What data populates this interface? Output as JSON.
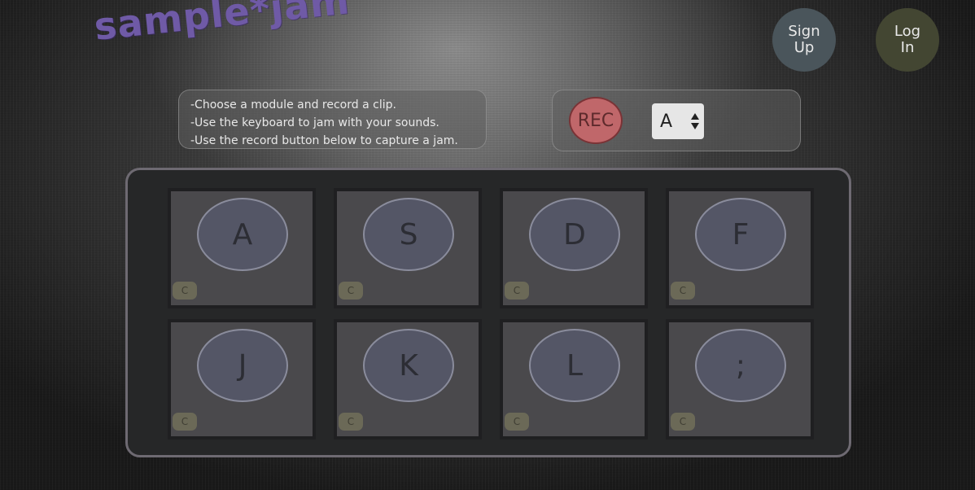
{
  "header": {
    "logo_text": "sample*jam",
    "signup_label": "Sign Up",
    "login_label": "Log In"
  },
  "instructions": {
    "lines": [
      "-Choose a module and record a clip.",
      "-Use the keyboard to jam with your sounds.",
      "-Use the record button below to capture a jam."
    ]
  },
  "controls": {
    "rec_label": "REC",
    "module_selected": "A"
  },
  "pads": [
    {
      "key": "A",
      "clear_label": "C"
    },
    {
      "key": "S",
      "clear_label": "C"
    },
    {
      "key": "D",
      "clear_label": "C"
    },
    {
      "key": "F",
      "clear_label": "C"
    },
    {
      "key": "J",
      "clear_label": "C"
    },
    {
      "key": "K",
      "clear_label": "C"
    },
    {
      "key": "L",
      "clear_label": "C"
    },
    {
      "key": ";",
      "clear_label": "C"
    }
  ],
  "colors": {
    "logo": "#6f5aa6",
    "signup_bg": "#4a555b",
    "login_bg": "#434632",
    "rec_bg": "#c0676a",
    "pad_key_bg": "#545666"
  }
}
